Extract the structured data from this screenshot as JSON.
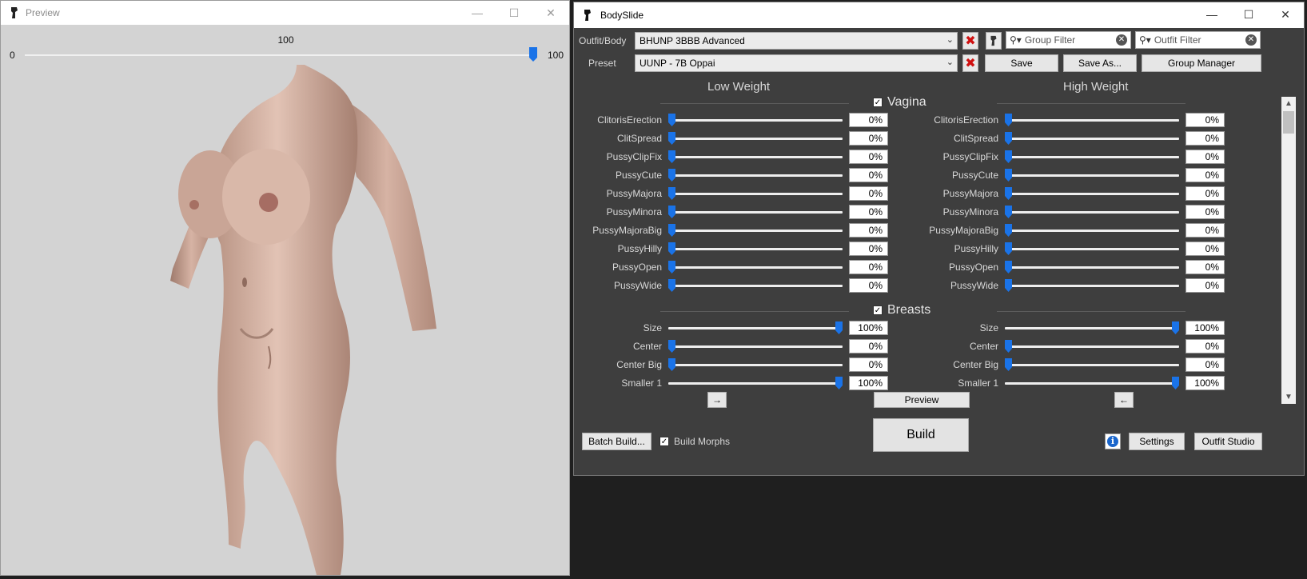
{
  "preview_window": {
    "title": "Preview",
    "zoom_value": "100",
    "zoom_min": "0",
    "zoom_max": "100",
    "zoom_fraction": 1.0
  },
  "bodyslide_window": {
    "title": "BodySlide",
    "outfit_label": "Outfit/Body",
    "outfit_value": "BHUNP 3BBB Advanced",
    "preset_label": "Preset",
    "preset_value": "UUNP - 7B Oppai",
    "group_filter_placeholder": "Group Filter",
    "outfit_filter_placeholder": "Outfit Filter",
    "save_label": "Save",
    "save_as_label": "Save As...",
    "group_manager_label": "Group Manager",
    "low_weight_label": "Low Weight",
    "high_weight_label": "High Weight",
    "copy_right_arrow": "→",
    "copy_left_arrow": "←",
    "preview_label": "Preview",
    "build_label": "Build",
    "batch_build_label": "Batch Build...",
    "build_morphs_label": "Build Morphs",
    "build_morphs_checked": true,
    "settings_label": "Settings",
    "outfit_studio_label": "Outfit Studio",
    "groups": [
      {
        "name": "Vagina",
        "checked": true,
        "sliders": [
          {
            "name": "ClitorisErection",
            "low": "0%",
            "high": "0%",
            "low_frac": 0,
            "high_frac": 0
          },
          {
            "name": "ClitSpread",
            "low": "0%",
            "high": "0%",
            "low_frac": 0,
            "high_frac": 0
          },
          {
            "name": "PussyClipFix",
            "low": "0%",
            "high": "0%",
            "low_frac": 0,
            "high_frac": 0
          },
          {
            "name": "PussyCute",
            "low": "0%",
            "high": "0%",
            "low_frac": 0,
            "high_frac": 0
          },
          {
            "name": "PussyMajora",
            "low": "0%",
            "high": "0%",
            "low_frac": 0,
            "high_frac": 0
          },
          {
            "name": "PussyMinora",
            "low": "0%",
            "high": "0%",
            "low_frac": 0,
            "high_frac": 0
          },
          {
            "name": "PussyMajoraBig",
            "low": "0%",
            "high": "0%",
            "low_frac": 0,
            "high_frac": 0
          },
          {
            "name": "PussyHilly",
            "low": "0%",
            "high": "0%",
            "low_frac": 0,
            "high_frac": 0
          },
          {
            "name": "PussyOpen",
            "low": "0%",
            "high": "0%",
            "low_frac": 0,
            "high_frac": 0
          },
          {
            "name": "PussyWide",
            "low": "0%",
            "high": "0%",
            "low_frac": 0,
            "high_frac": 0
          }
        ]
      },
      {
        "name": "Breasts",
        "checked": true,
        "sliders": [
          {
            "name": "Size",
            "low": "100%",
            "high": "100%",
            "low_frac": 1,
            "high_frac": 1
          },
          {
            "name": "Center",
            "low": "0%",
            "high": "0%",
            "low_frac": 0,
            "high_frac": 0
          },
          {
            "name": "Center Big",
            "low": "0%",
            "high": "0%",
            "low_frac": 0,
            "high_frac": 0
          },
          {
            "name": "Smaller 1",
            "low": "100%",
            "high": "100%",
            "low_frac": 1,
            "high_frac": 1
          }
        ]
      }
    ]
  },
  "colors": {
    "accent": "#1a73e8",
    "panel_bg": "#3e3e3e",
    "preview_bg": "#d3d3d3",
    "clear_red": "#d01010"
  },
  "icons": {
    "app": "bodyslide-app-icon",
    "minimize": "minimize-icon",
    "maximize": "maximize-icon",
    "close": "close-icon",
    "search": "search-icon",
    "clear": "clear-icon",
    "info": "info-icon"
  }
}
